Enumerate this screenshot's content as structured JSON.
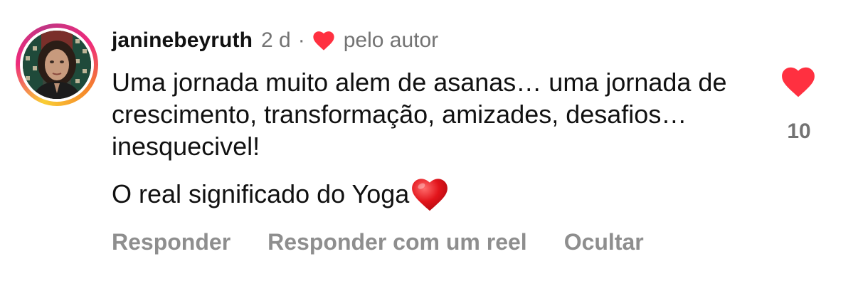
{
  "comment": {
    "username": "janinebeyruth",
    "time": "2 d",
    "separator": "·",
    "liked_by_author_label": "pelo autor",
    "body_paragraph_1": "Uma jornada muito alem de asanas… uma jornada de crescimento, transformação, amizades, desafios… inesquecivel!",
    "body_paragraph_2": "O real significado do Yoga",
    "body_paragraph_2_emoji": "red-heart-emoji",
    "like_count": "10",
    "like_icon": "heart-icon",
    "liked": true
  },
  "actions": {
    "reply": "Responder",
    "reply_with_reel": "Responder com um reel",
    "hide": "Ocultar"
  },
  "colors": {
    "heart_red": "#ff3040",
    "secondary_text": "#737373",
    "action_text": "#8e8e8e",
    "primary_text": "#111111"
  }
}
